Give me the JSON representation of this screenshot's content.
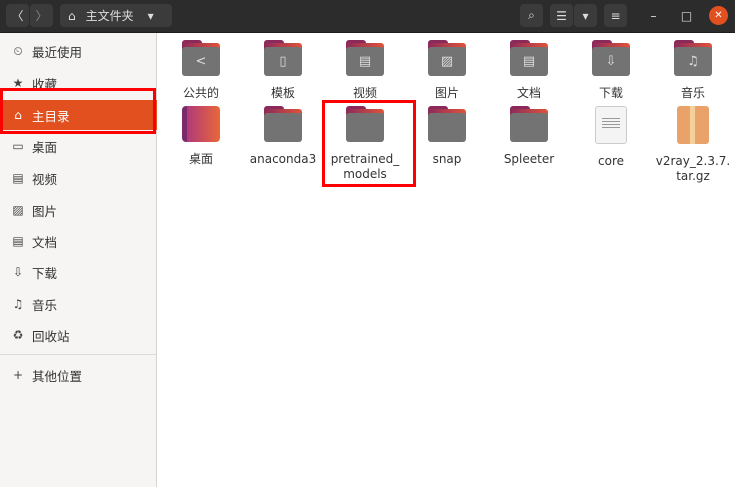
{
  "header": {
    "back": "〈",
    "forward": "〉",
    "location": "主文件夹",
    "location_dropdown": "▾",
    "search": "⌕",
    "view_list": "☰",
    "view_dropdown": "▾",
    "menu": "≡",
    "minimize": "–",
    "maximize": "□",
    "close": "✕"
  },
  "sidebar": {
    "items": [
      {
        "label": "最近使用",
        "icon": "⏲"
      },
      {
        "label": "收藏",
        "icon": "★"
      },
      {
        "label": "主目录",
        "icon": "⌂"
      },
      {
        "label": "桌面",
        "icon": "▭"
      },
      {
        "label": "视频",
        "icon": "▤"
      },
      {
        "label": "图片",
        "icon": "▨"
      },
      {
        "label": "文档",
        "icon": "▤"
      },
      {
        "label": "下载",
        "icon": "⇩"
      },
      {
        "label": "音乐",
        "icon": "♫"
      },
      {
        "label": "回收站",
        "icon": "♻"
      }
    ],
    "other": {
      "label": "其他位置",
      "icon": "+"
    }
  },
  "files": [
    {
      "name": "公共的",
      "type": "folder",
      "glyph": "<"
    },
    {
      "name": "模板",
      "type": "folder",
      "glyph": "▯"
    },
    {
      "name": "视频",
      "type": "folder",
      "glyph": "▤"
    },
    {
      "name": "图片",
      "type": "folder",
      "glyph": "▨"
    },
    {
      "name": "文档",
      "type": "folder",
      "glyph": "▤"
    },
    {
      "name": "下载",
      "type": "folder",
      "glyph": "⇩"
    },
    {
      "name": "音乐",
      "type": "folder",
      "glyph": "♫"
    },
    {
      "name": "桌面",
      "type": "desktop",
      "glyph": ""
    },
    {
      "name": "anaconda3",
      "type": "folder",
      "glyph": ""
    },
    {
      "name": "pretrained_ models",
      "type": "folder",
      "glyph": ""
    },
    {
      "name": "snap",
      "type": "folder",
      "glyph": ""
    },
    {
      "name": "Spleeter",
      "type": "folder",
      "glyph": ""
    },
    {
      "name": "core",
      "type": "text",
      "glyph": ""
    },
    {
      "name": "v2ray_2.3.7. tar.gz",
      "type": "archive",
      "glyph": ""
    }
  ],
  "colors": {
    "accent": "#e1501e",
    "header": "#2c2c2c",
    "folder": "#737373",
    "highlight": "#ff0000"
  }
}
